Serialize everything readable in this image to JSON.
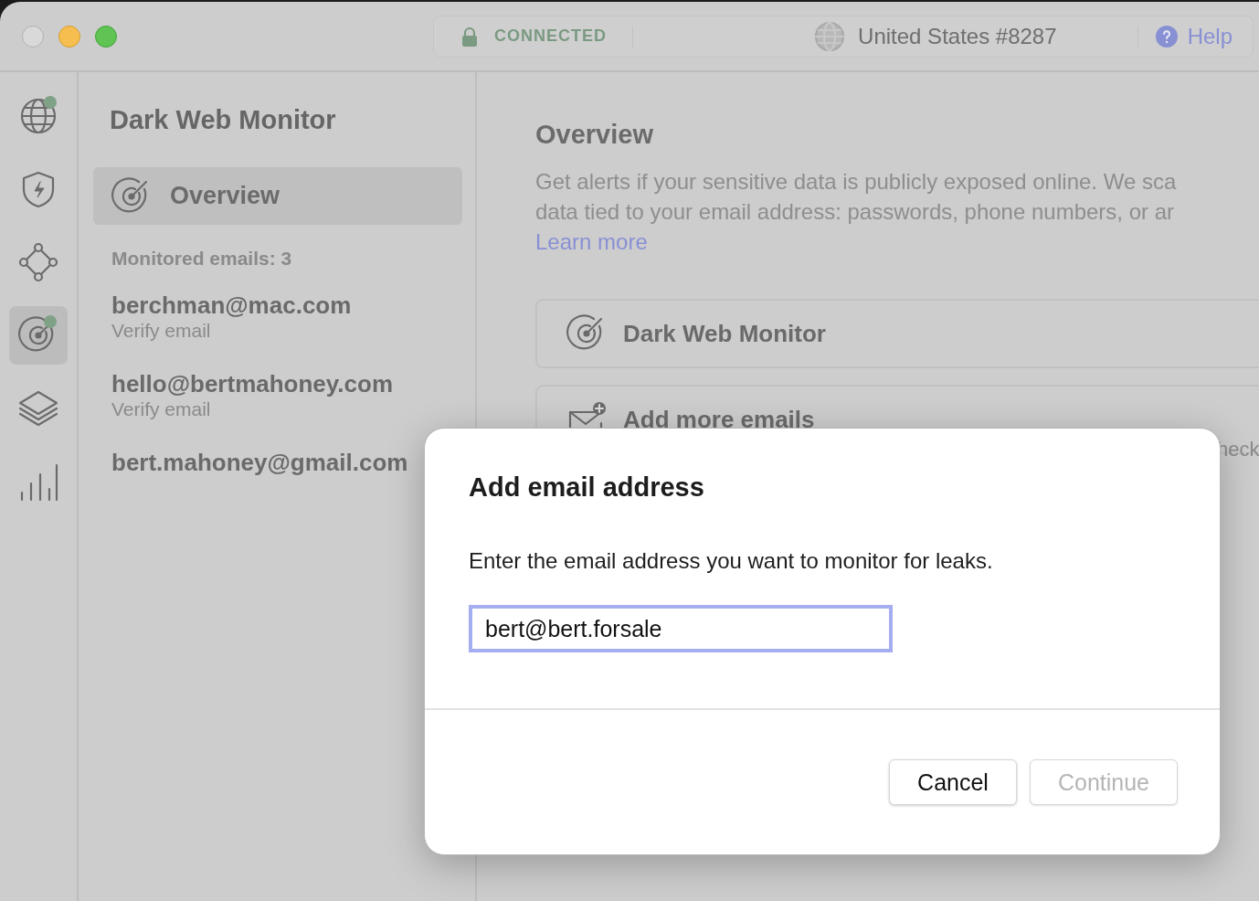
{
  "window": {
    "traffic_lights": [
      {
        "kind": "close",
        "disabled": true
      },
      {
        "kind": "minimize",
        "disabled": false
      },
      {
        "kind": "zoom",
        "disabled": false
      }
    ]
  },
  "status_pill": {
    "connection": "CONNECTED",
    "connected": true,
    "server": "United States #8287",
    "help": "Help"
  },
  "rail": [
    {
      "kind": "globe",
      "selected": false,
      "notified": true
    },
    {
      "kind": "shield",
      "selected": false,
      "notified": false
    },
    {
      "kind": "nodes",
      "selected": false,
      "notified": false
    },
    {
      "kind": "target",
      "selected": true,
      "notified": true
    },
    {
      "kind": "layers",
      "selected": false,
      "notified": false
    },
    {
      "kind": "bars",
      "selected": false,
      "notified": false
    }
  ],
  "sidebar": {
    "title": "Dark Web Monitor",
    "items": [
      {
        "label": "Overview",
        "selected": true
      }
    ],
    "count_label": "Monitored emails: 3",
    "emails": [
      {
        "address": "berchman@mac.com",
        "status": "Verify email"
      },
      {
        "address": "hello@bertmahoney.com",
        "status": "Verify email"
      },
      {
        "address": "bert.mahoney@gmail.com"
      }
    ]
  },
  "content": {
    "title": "Overview",
    "description_lines": [
      "Get alerts if your sensitive data is publicly exposed online. We sca",
      "data tied to your email address: passwords, phone numbers, or ar"
    ],
    "link": "Learn more",
    "cards": [
      {
        "kind": "target",
        "title": "Dark Web Monitor"
      },
      {
        "kind": "mail",
        "title": "Add more emails",
        "note": "heck"
      }
    ]
  },
  "dialog": {
    "title": "Add email address",
    "message": "Enter the email address you want to monitor for leaks.",
    "input": {
      "value": "bert@bert.forsale",
      "focused": true
    },
    "buttons": [
      {
        "label": "Cancel",
        "disabled": false
      },
      {
        "label": "Continue",
        "disabled": true
      }
    ]
  }
}
